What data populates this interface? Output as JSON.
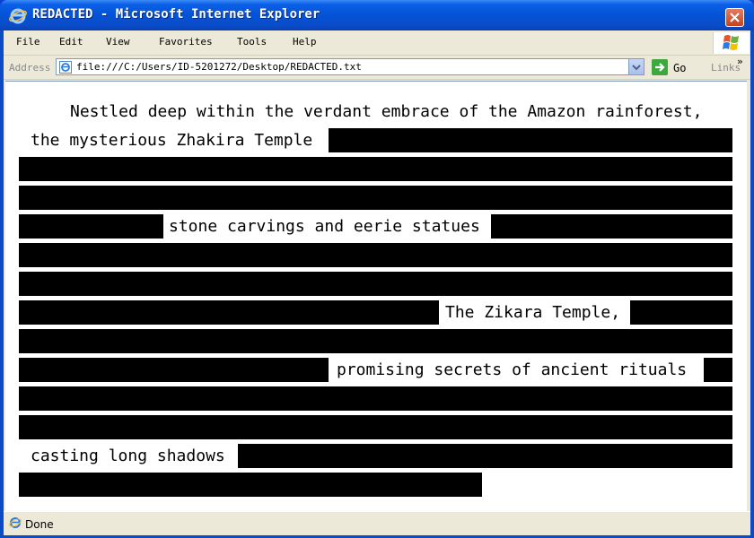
{
  "window": {
    "title": "REDACTED - Microsoft Internet Explorer"
  },
  "menu": [
    "File",
    "Edit",
    "View",
    "Favorites",
    "Tools",
    "Help"
  ],
  "address": {
    "label": "Address",
    "url": "file:///C:/Users/ID-5201272/Desktop/REDACTED.txt",
    "go_label": "Go",
    "links_label": "Links"
  },
  "document": {
    "line1": "Nestled deep within the verdant embrace of the Amazon rainforest,",
    "line2": "the mysterious Zhakira Temple",
    "line5": "stone carvings and eerie statues",
    "line8": "The Zikara Temple,",
    "line10": "promising secrets of ancient rituals",
    "line13": "casting long shadows"
  },
  "status": {
    "text": "Done"
  },
  "icons": {
    "browser": "ie-logo-icon",
    "close": "close-icon",
    "windows": "windows-logo-icon",
    "page": "ie-page-icon",
    "go": "go-arrow-icon",
    "dropdown": "chevron-down-icon",
    "links": "chevron-right-icon"
  },
  "colors": {
    "title_bar": "#0553d6",
    "redaction": "#000000",
    "chrome": "#ece9d8"
  }
}
